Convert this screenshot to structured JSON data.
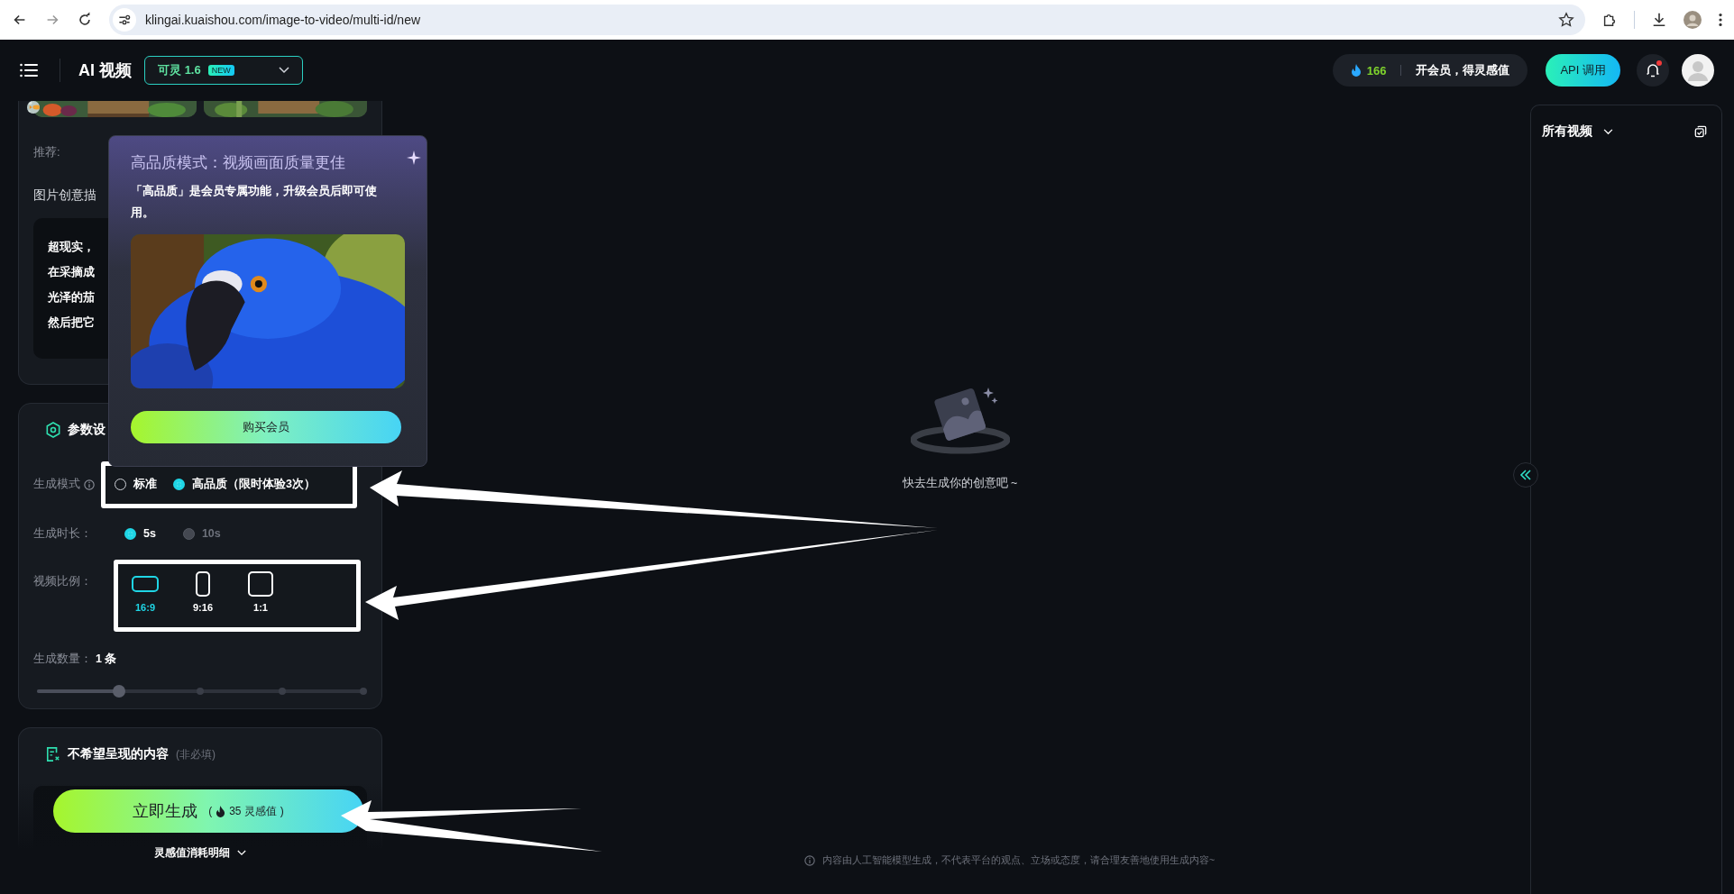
{
  "browser": {
    "url": "klingai.kuaishou.com/image-to-video/multi-id/new"
  },
  "header": {
    "title": "AI 视频",
    "model": {
      "label": "可灵 1.6",
      "badge": "NEW"
    },
    "credits": "166",
    "membership": "开会员，得灵感值",
    "api_button": "API 调用",
    "has_notification": true
  },
  "prompt_card": {
    "recommend_label": "推荐:",
    "description_label": "图片创意描",
    "description_lines": [
      "超现实，",
      "在采摘成",
      "光泽的茄",
      "然后把它"
    ]
  },
  "params": {
    "title": "参数设",
    "mode": {
      "label": "生成模式",
      "options": [
        {
          "label": "标准",
          "selected": false,
          "disabled": false
        },
        {
          "label": "高品质（限时体验3次）",
          "selected": true,
          "disabled": false
        }
      ]
    },
    "duration": {
      "label": "生成时长：",
      "options": [
        {
          "label": "5s",
          "selected": true,
          "disabled": false
        },
        {
          "label": "10s",
          "selected": false,
          "disabled": true
        }
      ]
    },
    "ratio": {
      "label": "视频比例：",
      "options": [
        {
          "label": "16:9",
          "kind": "wide",
          "selected": true
        },
        {
          "label": "9:16",
          "kind": "tall",
          "selected": false
        },
        {
          "label": "1:1",
          "kind": "square",
          "selected": false
        }
      ]
    },
    "count": {
      "label": "生成数量：",
      "value": "1 条",
      "level": 0.25
    }
  },
  "negative": {
    "title": "不希望呈现的内容",
    "hint": "(非必填)"
  },
  "generate": {
    "label": "立即生成",
    "open": "(",
    "cost": "35 灵感值",
    "close": ")"
  },
  "cost_detail": "灵感值消耗明细",
  "popup": {
    "title": "高品质模式：视频画面质量更佳",
    "body": "「高品质」是会员专属功能，升级会员后即可使用。",
    "button": "购买会员"
  },
  "empty_state": "快去生成你的创意吧 ~",
  "disclaimer": "内容由人工智能模型生成，不代表平台的观点、立场或态度，请合理友善地使用生成内容~",
  "right_panel": {
    "filter": "所有视频"
  }
}
